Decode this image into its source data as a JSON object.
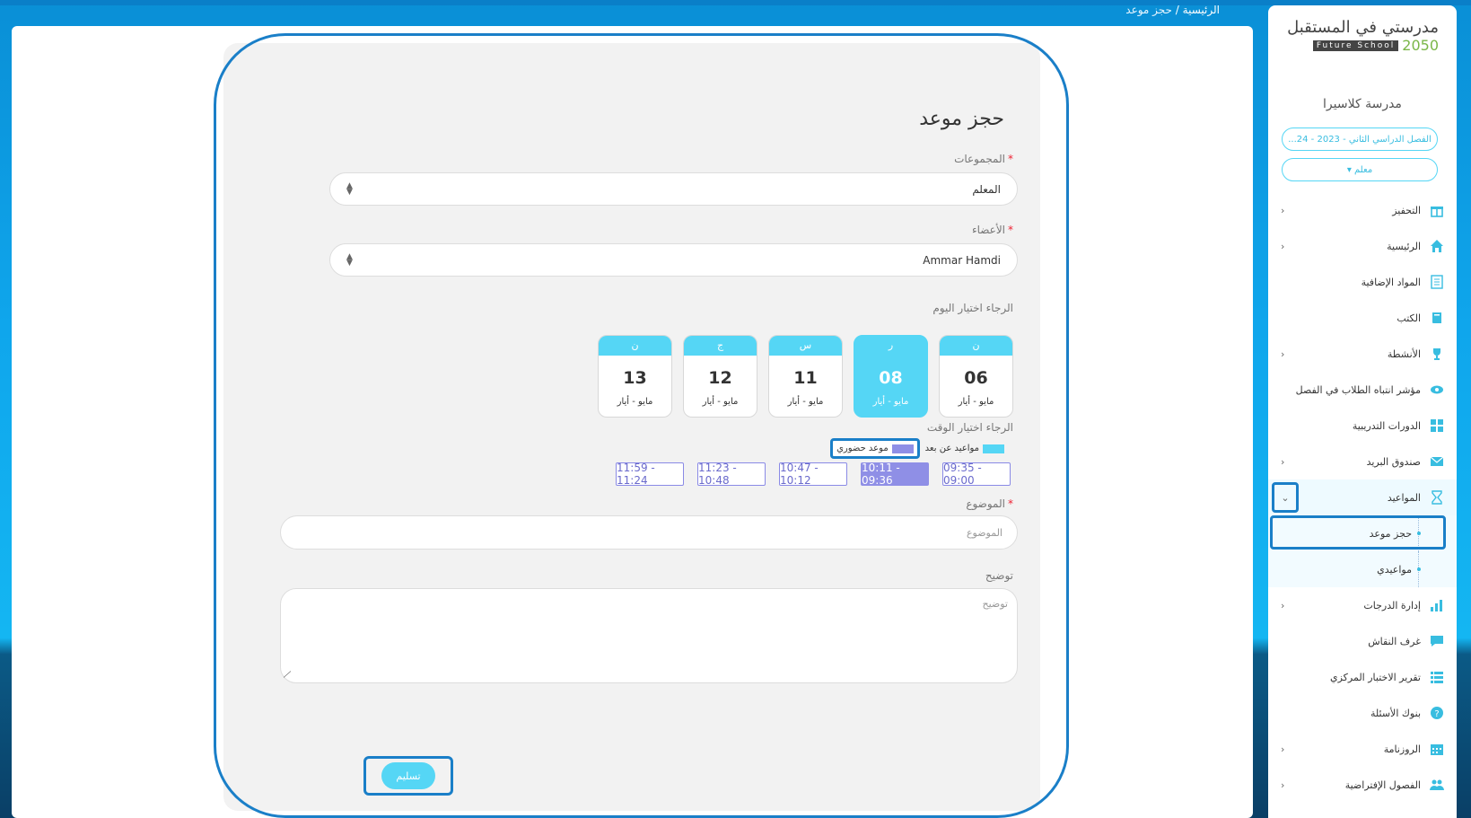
{
  "breadcrumb": {
    "home": "الرئيسية",
    "separator": "/",
    "current": "حجز موعد"
  },
  "form": {
    "title": "حجز موعد",
    "groups": {
      "label": "المجموعات",
      "required_mark": "*",
      "value": "المعلم"
    },
    "members": {
      "label": "الأعضاء",
      "required_mark": "*",
      "value": "Ammar Hamdi"
    },
    "day_prompt": "الرجاء اختيار اليوم",
    "days": [
      {
        "letter": "ن",
        "day": "06",
        "month": "مايو - أيار",
        "selected": false
      },
      {
        "letter": "ر",
        "day": "08",
        "month": "مايو - أيار",
        "selected": true
      },
      {
        "letter": "س",
        "day": "11",
        "month": "مايو - أيار",
        "selected": false
      },
      {
        "letter": "ج",
        "day": "12",
        "month": "مايو - أيار",
        "selected": false
      },
      {
        "letter": "ن",
        "day": "13",
        "month": "مايو - أيار",
        "selected": false
      }
    ],
    "time_prompt": "الرجاء اختيار الوقت",
    "legend": {
      "remote": "مواعيد عن بعد",
      "remote_color": "#55d6f5",
      "in_person": "موعد حضوري",
      "in_person_color": "#8f8fe6"
    },
    "slots": [
      {
        "label": "09:35 - 09:00",
        "selected": false
      },
      {
        "label": "10:11 - 09:36",
        "selected": true
      },
      {
        "label": "10:47 - 10:12",
        "selected": false
      },
      {
        "label": "11:23 - 10:48",
        "selected": false
      },
      {
        "label": "11:59 - 11:24",
        "selected": false
      }
    ],
    "subject": {
      "label": "الموضوع",
      "required_mark": "*",
      "placeholder": "الموضوع"
    },
    "description": {
      "label": "توضيح",
      "placeholder": "توضيح"
    },
    "submit_label": "تسليم"
  },
  "sidebar": {
    "logo_ar": "مدرستي في المستقبل",
    "logo_en": "Future School",
    "logo_year": "2050",
    "school_name": "مدرسة كلاسيرا",
    "semester": "الفصل الدراسي الثاني - 2023 - 24...",
    "role": "معلم ▾",
    "items": [
      {
        "label": "التحفيز",
        "icon": "gift-icon",
        "chevron": true
      },
      {
        "label": "الرئيسية",
        "icon": "home-icon",
        "chevron": true
      },
      {
        "label": "المواد الإضافية",
        "icon": "document-icon",
        "chevron": false
      },
      {
        "label": "الكتب",
        "icon": "book-icon",
        "chevron": false
      },
      {
        "label": "الأنشطة",
        "icon": "trophy-icon",
        "chevron": true
      },
      {
        "label": "مؤشر انتباه الطلاب في الفصل",
        "icon": "eye-icon",
        "chevron": false
      },
      {
        "label": "الدورات التدريبية",
        "icon": "grid-icon",
        "chevron": false
      },
      {
        "label": "صندوق البريد",
        "icon": "mail-icon",
        "chevron": true
      },
      {
        "label": "المواعيد",
        "icon": "hourglass-icon",
        "chevron": true,
        "open": true
      },
      {
        "label": "حجز موعد",
        "sub": true,
        "active": true
      },
      {
        "label": "مواعيدي",
        "sub": true
      },
      {
        "label": "إدارة الدرجات",
        "icon": "bar-chart-icon",
        "chevron": true
      },
      {
        "label": "غرف النقاش",
        "icon": "chat-icon",
        "chevron": false
      },
      {
        "label": "تقرير الاختبار المركزي",
        "icon": "list-icon",
        "chevron": false
      },
      {
        "label": "بنوك الأسئلة",
        "icon": "question-icon",
        "chevron": false
      },
      {
        "label": "الروزنامة",
        "icon": "calendar-icon",
        "chevron": true
      },
      {
        "label": "الفصول الإفتراضية",
        "icon": "users-icon",
        "chevron": true
      }
    ]
  },
  "colors": {
    "accent": "#55d6f5",
    "highlight": "#1a7fc8",
    "slot": "#8f8fe6"
  }
}
